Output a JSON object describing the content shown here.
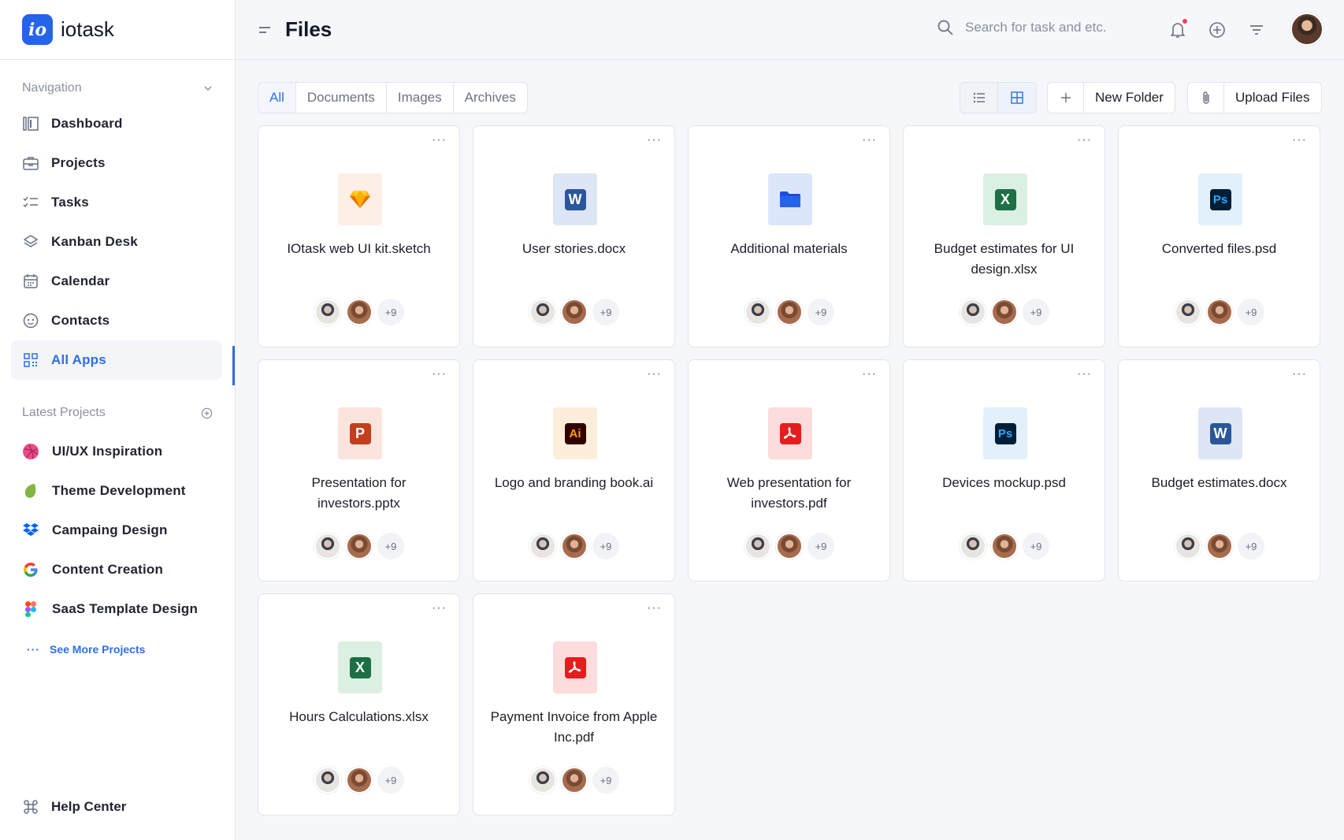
{
  "brand": {
    "logo": "io",
    "name": "iotask"
  },
  "sidebar": {
    "nav_title": "Navigation",
    "items": [
      {
        "label": "Dashboard",
        "icon": "dashboard-icon"
      },
      {
        "label": "Projects",
        "icon": "briefcase-icon"
      },
      {
        "label": "Tasks",
        "icon": "checklist-icon"
      },
      {
        "label": "Kanban Desk",
        "icon": "layers-icon"
      },
      {
        "label": "Calendar",
        "icon": "calendar-icon"
      },
      {
        "label": "Contacts",
        "icon": "contacts-icon"
      },
      {
        "label": "All Apps",
        "icon": "apps-grid-icon",
        "active": true
      }
    ],
    "projects_title": "Latest Projects",
    "projects": [
      {
        "label": "UI/UX Inspiration",
        "icon": "dribbble-icon"
      },
      {
        "label": "Theme Development",
        "icon": "envato-leaf-icon"
      },
      {
        "label": "Campaing Design",
        "icon": "dropbox-icon"
      },
      {
        "label": "Content Creation",
        "icon": "google-icon"
      },
      {
        "label": "SaaS Template Design",
        "icon": "figma-icon"
      }
    ],
    "see_more": "See More Projects",
    "help": "Help Center"
  },
  "header": {
    "title": "Files",
    "search_placeholder": "Search for task and etc."
  },
  "toolbar": {
    "tabs": [
      "All",
      "Documents",
      "Images",
      "Archives"
    ],
    "active_tab": "All",
    "new_folder": "New Folder",
    "upload_files": "Upload Files"
  },
  "colors": {
    "accent": "#2f6fe0",
    "notification_dot": "#f43f5e"
  },
  "files": [
    {
      "name": "IOtask web UI kit.sketch",
      "type": "sketch",
      "members_more": "+9"
    },
    {
      "name": "User stories.docx",
      "type": "word",
      "members_more": "+9"
    },
    {
      "name": "Additional materials",
      "type": "folder",
      "members_more": "+9"
    },
    {
      "name": "Budget estimates for UI design.xlsx",
      "type": "excel",
      "members_more": "+9"
    },
    {
      "name": "Converted files.psd",
      "type": "photoshop",
      "members_more": "+9"
    },
    {
      "name": "Presentation for investors.pptx",
      "type": "powerpoint",
      "members_more": "+9"
    },
    {
      "name": "Logo and branding book.ai",
      "type": "illustrator",
      "members_more": "+9"
    },
    {
      "name": "Web presentation for investors.pdf",
      "type": "pdf",
      "members_more": "+9"
    },
    {
      "name": "Devices mockup.psd",
      "type": "photoshop",
      "members_more": "+9"
    },
    {
      "name": "Budget estimates.docx",
      "type": "word",
      "members_more": "+9"
    },
    {
      "name": "Hours Calculations.xlsx",
      "type": "excel",
      "members_more": "+9"
    },
    {
      "name": "Payment Invoice from Apple Inc.pdf",
      "type": "pdf",
      "members_more": "+9"
    }
  ]
}
